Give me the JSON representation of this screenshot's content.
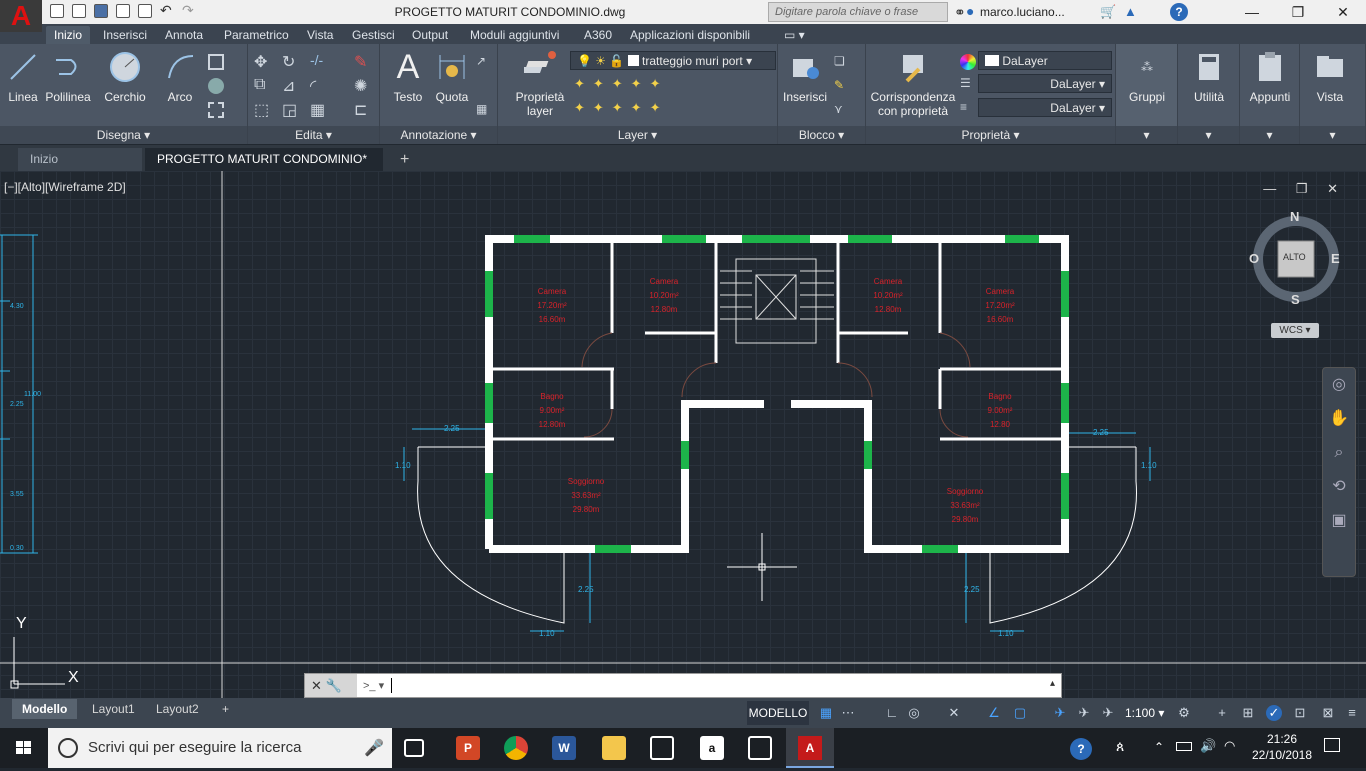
{
  "app": {
    "title": "PROGETTO MATURIT CONDOMINIO.dwg",
    "logo": "A",
    "search_placeholder": "Digitare parola chiave o frase",
    "user": "marco.luciano...",
    "help": "?",
    "win_min": "—",
    "win_max": "❐",
    "win_close": "✕"
  },
  "ribbon_tabs": [
    "Inizio",
    "Inserisci",
    "Annota",
    "Parametrico",
    "Vista",
    "Gestisci",
    "Output",
    "Moduli aggiuntivi",
    "A360",
    "Applicazioni disponibili"
  ],
  "panels": {
    "disegna": {
      "title": "Disegna ▾",
      "buttons": [
        "Linea",
        "Polilinea",
        "Cerchio",
        "Arco"
      ]
    },
    "edita": {
      "title": "Edita ▾"
    },
    "annotazione": {
      "title": "Annotazione ▾",
      "buttons": [
        "Testo",
        "Quota"
      ]
    },
    "layer": {
      "title": "Layer ▾",
      "button_line1": "Proprietà",
      "button_line2": "layer",
      "current_layer": "tratteggio muri port"
    },
    "blocco": {
      "title": "Blocco ▾",
      "button": "Inserisci"
    },
    "proprieta": {
      "title": "Proprietà ▾",
      "button_line1": "Corrispondenza",
      "button_line2": "con proprietà",
      "color": "DaLayer",
      "linetype": "DaLayer",
      "lineweight": "DaLayer"
    },
    "gruppi": "Gruppi",
    "utilita": "Utilità",
    "appunti": "Appunti",
    "vista": "Vista"
  },
  "file_tabs": {
    "home": "Inizio",
    "active": "PROGETTO MATURIT CONDOMINIO*",
    "close": "✕",
    "add": "+"
  },
  "viewport": {
    "label": "[−][Alto][Wireframe 2D]",
    "controls": "— ❐ ✕"
  },
  "viewcube": {
    "n": "N",
    "s": "S",
    "e": "E",
    "w": "O",
    "face": "ALTO",
    "wcs": "WCS ▾"
  },
  "ucs": {
    "x": "X",
    "y": "Y"
  },
  "rooms": [
    {
      "name": "Camera",
      "area": "17.20m²",
      "perim": "16.60m"
    },
    {
      "name": "Camera",
      "area": "10.20m²",
      "perim": "12.80m"
    },
    {
      "name": "Camera",
      "area": "10.20m²",
      "perim": "12.80m"
    },
    {
      "name": "Camera",
      "area": "17.20m²",
      "perim": "16.60m"
    },
    {
      "name": "Bagno",
      "area": "9.00m²",
      "perim": "12.80m"
    },
    {
      "name": "Bagno",
      "area": "9.00m²",
      "perim": "12.80"
    },
    {
      "name": "Soggiorno",
      "area": "33.63m²",
      "perim": "29.80m"
    },
    {
      "name": "Soggiorno",
      "area": "33.63m²",
      "perim": "29.80m"
    }
  ],
  "dims": {
    "balcony_w": "2.25",
    "balcony_h": "1.10",
    "bottom_v": "2.25",
    "bottom_h": "1.10",
    "side": [
      "4.30",
      "2.25",
      "3.55",
      "11.00",
      "0.30"
    ]
  },
  "command": {
    "handle_close": "✕",
    "handle_tool": "🔧",
    "prompt": ">_ ▾",
    "scroll": "▴"
  },
  "layouts": [
    "Modello",
    "Layout1",
    "Layout2",
    "+"
  ],
  "status": {
    "model": "MODELLO",
    "scale": "1:100 ▾"
  },
  "taskbar": {
    "search": "Scrivi qui per eseguire la ricerca",
    "time": "21:26",
    "date": "22/10/2018"
  }
}
